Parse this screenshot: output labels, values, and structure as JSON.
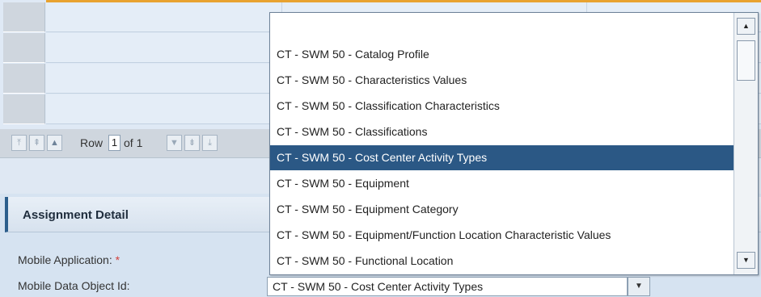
{
  "pager": {
    "row_label": "Row",
    "current_row": "1",
    "of_text": "of 1",
    "first_icon": "first-page-icon",
    "prev_page_icon": "previous-page-icon",
    "prev_row_icon": "previous-row-icon",
    "next_row_icon": "next-row-icon",
    "next_page_icon": "next-page-icon",
    "last_icon": "last-page-icon"
  },
  "assignment_detail": {
    "title": "Assignment Detail",
    "mobile_application_label": "Mobile Application:",
    "required_marker": "*",
    "mobile_data_object_label": "Mobile Data Object Id:",
    "mobile_data_object_value": "CT - SWM 50 - Cost Center Activity Types"
  },
  "dropdown": {
    "items": [
      "",
      "CT - SWM 50 - Catalog Profile",
      "CT - SWM 50 - Characteristics Values",
      "CT - SWM 50 - Classification Characteristics",
      "CT - SWM 50 - Classifications",
      "CT - SWM 50 - Cost Center Activity Types",
      "CT - SWM 50 - Equipment",
      "CT - SWM 50 - Equipment Category",
      "CT - SWM 50 - Equipment/Function Location Characteristic Values",
      "CT - SWM 50 - Functional Location"
    ],
    "selected_index": 5
  },
  "colors": {
    "selection": "#2b5885",
    "header_accent": "#2c5e8c",
    "table_top_accent": "#e8a230",
    "required": "#d4403a"
  }
}
